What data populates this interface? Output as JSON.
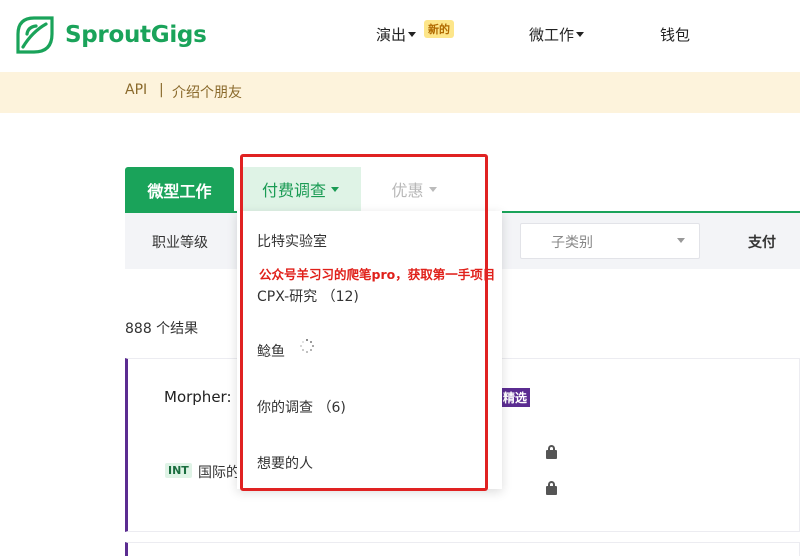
{
  "header": {
    "brand": "SproutGigs",
    "nav": {
      "shows": "演出",
      "new_badge": "新的",
      "micro_jobs": "微工作",
      "wallet": "钱包"
    }
  },
  "subnav": {
    "api": "API",
    "separator": "|",
    "refer": "介绍个朋友"
  },
  "tabs": {
    "micro": "微型工作",
    "paid_surveys": "付费调查",
    "offers": "优惠"
  },
  "filters": {
    "job_level": "职业等级",
    "subcategory": "子类别",
    "pay": "支付"
  },
  "results_count": "888 个结果",
  "card": {
    "title": "Morpher:",
    "featured_badge": "精选",
    "int_badge": "INT",
    "int_label": "国际的"
  },
  "dropdown": {
    "items": [
      {
        "label": "比特实验室"
      },
      {
        "label": "CPX-研究 （12)"
      },
      {
        "label": "鲶鱼"
      },
      {
        "label": "你的调查 （6)"
      },
      {
        "label": "想要的人"
      }
    ]
  },
  "watermark": "公众号羊习习的爬笔pro，获取第一手项目",
  "colors": {
    "brand_green": "#1aa35a",
    "featured_purple": "#5b2c91",
    "highlight_red": "#e02222",
    "subnav_bg": "#fdf3dc"
  }
}
